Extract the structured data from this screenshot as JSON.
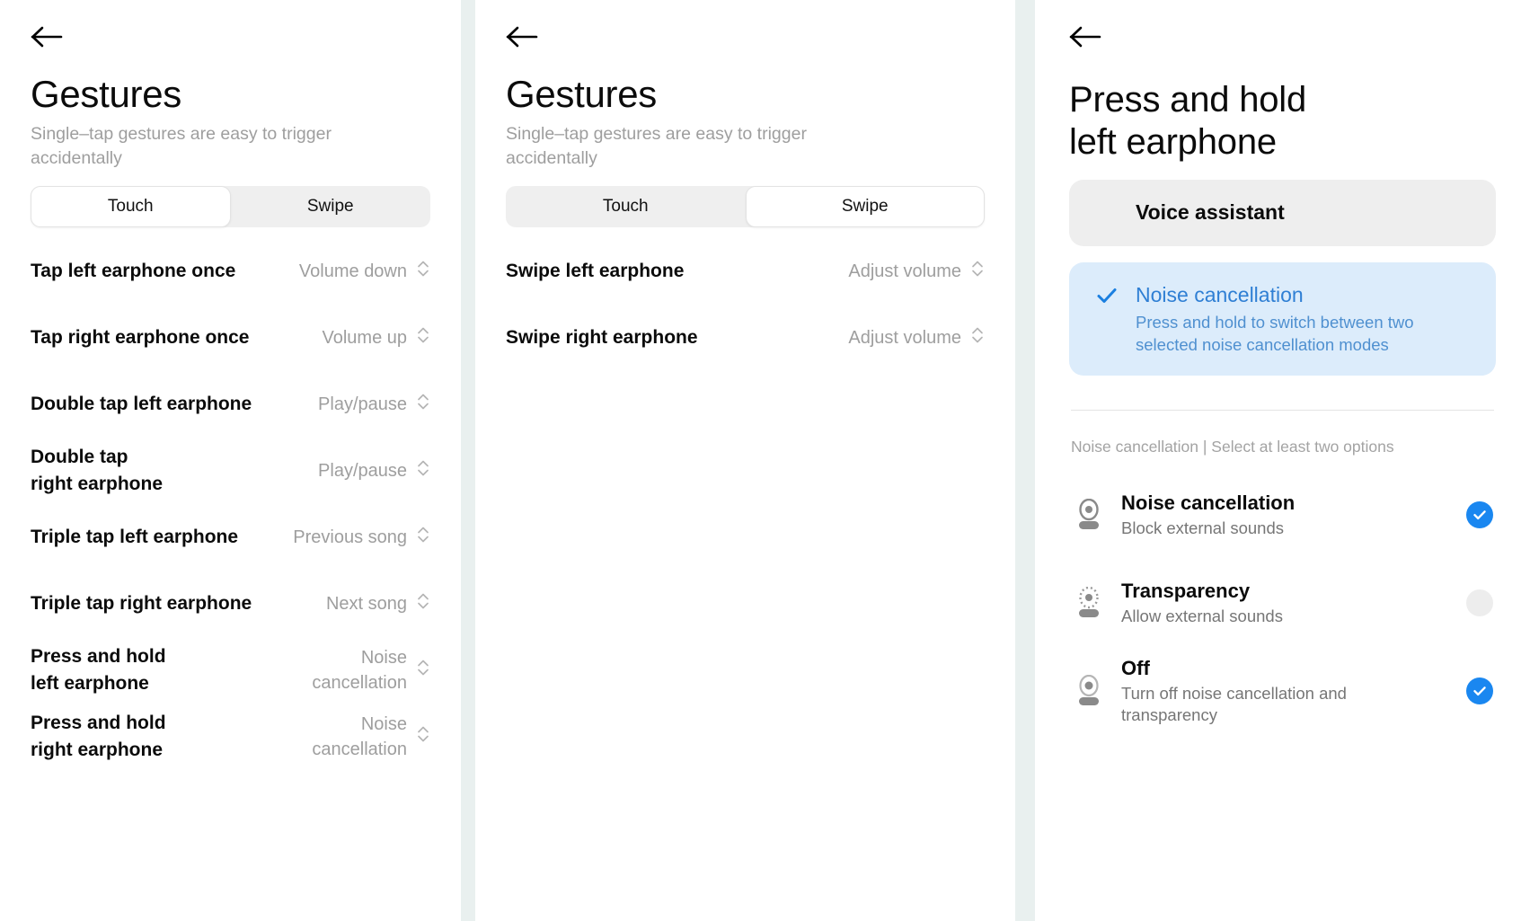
{
  "colors": {
    "accent": "#1a87f0",
    "accent_text": "#2f7fd4",
    "selected_card_bg": "#dcecfb",
    "card_bg": "#eeeeee",
    "muted_text": "#9e9e9e",
    "gutter": "#e9f0ef"
  },
  "panel_touch": {
    "back_icon": "arrow-left-icon",
    "title": "Gestures",
    "subtitle": "Single–tap gestures are easy to trigger accidentally",
    "tabs": [
      {
        "label": "Touch",
        "active": true
      },
      {
        "label": "Swipe",
        "active": false
      }
    ],
    "rows": [
      {
        "label": "Tap left earphone once",
        "value": "Volume down"
      },
      {
        "label": "Tap right earphone once",
        "value": "Volume up"
      },
      {
        "label": "Double tap left earphone",
        "value": "Play/pause"
      },
      {
        "label": "Double tap\nright earphone",
        "value": "Play/pause"
      },
      {
        "label": "Triple tap left earphone",
        "value": "Previous song"
      },
      {
        "label": "Triple tap right earphone",
        "value": "Next song"
      },
      {
        "label": "Press and hold\nleft earphone",
        "value": "Noise\ncancellation"
      },
      {
        "label": "Press and hold\nright earphone",
        "value": "Noise\ncancellation"
      }
    ]
  },
  "panel_swipe": {
    "back_icon": "arrow-left-icon",
    "title": "Gestures",
    "subtitle": "Single–tap gestures are easy to trigger accidentally",
    "tabs": [
      {
        "label": "Touch",
        "active": false
      },
      {
        "label": "Swipe",
        "active": true
      }
    ],
    "rows": [
      {
        "label": "Swipe left earphone",
        "value": "Adjust volume"
      },
      {
        "label": "Swipe right earphone",
        "value": "Adjust volume"
      }
    ]
  },
  "panel_detail": {
    "back_icon": "arrow-left-icon",
    "title": "Press and hold\nleft earphone",
    "cards": [
      {
        "title": "Voice assistant",
        "description": "",
        "selected": false
      },
      {
        "title": "Noise cancellation",
        "description": "Press and hold to switch between two selected noise cancellation modes",
        "selected": true,
        "check_icon": "check-icon"
      }
    ],
    "section_caption": "Noise cancellation | Select at least two options",
    "modes": [
      {
        "icon": "noise-cancellation-icon",
        "title": "Noise cancellation",
        "description": "Block external sounds",
        "checked": true
      },
      {
        "icon": "transparency-icon",
        "title": "Transparency",
        "description": "Allow external sounds",
        "checked": false
      },
      {
        "icon": "off-icon",
        "title": "Off",
        "description": "Turn off noise cancellation and transparency",
        "checked": true
      }
    ]
  }
}
